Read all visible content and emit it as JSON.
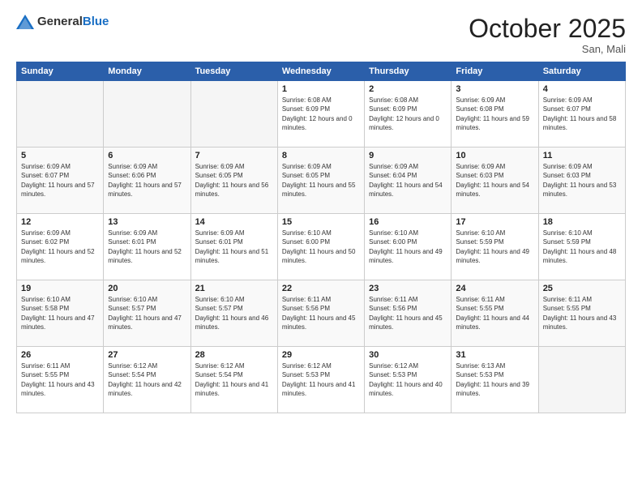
{
  "header": {
    "logo_general": "General",
    "logo_blue": "Blue",
    "month_title": "October 2025",
    "location": "San, Mali"
  },
  "weekdays": [
    "Sunday",
    "Monday",
    "Tuesday",
    "Wednesday",
    "Thursday",
    "Friday",
    "Saturday"
  ],
  "weeks": [
    [
      {
        "day": "",
        "sunrise": "",
        "sunset": "",
        "daylight": ""
      },
      {
        "day": "",
        "sunrise": "",
        "sunset": "",
        "daylight": ""
      },
      {
        "day": "",
        "sunrise": "",
        "sunset": "",
        "daylight": ""
      },
      {
        "day": "1",
        "sunrise": "Sunrise: 6:08 AM",
        "sunset": "Sunset: 6:09 PM",
        "daylight": "Daylight: 12 hours and 0 minutes."
      },
      {
        "day": "2",
        "sunrise": "Sunrise: 6:08 AM",
        "sunset": "Sunset: 6:09 PM",
        "daylight": "Daylight: 12 hours and 0 minutes."
      },
      {
        "day": "3",
        "sunrise": "Sunrise: 6:09 AM",
        "sunset": "Sunset: 6:08 PM",
        "daylight": "Daylight: 11 hours and 59 minutes."
      },
      {
        "day": "4",
        "sunrise": "Sunrise: 6:09 AM",
        "sunset": "Sunset: 6:07 PM",
        "daylight": "Daylight: 11 hours and 58 minutes."
      }
    ],
    [
      {
        "day": "5",
        "sunrise": "Sunrise: 6:09 AM",
        "sunset": "Sunset: 6:07 PM",
        "daylight": "Daylight: 11 hours and 57 minutes."
      },
      {
        "day": "6",
        "sunrise": "Sunrise: 6:09 AM",
        "sunset": "Sunset: 6:06 PM",
        "daylight": "Daylight: 11 hours and 57 minutes."
      },
      {
        "day": "7",
        "sunrise": "Sunrise: 6:09 AM",
        "sunset": "Sunset: 6:05 PM",
        "daylight": "Daylight: 11 hours and 56 minutes."
      },
      {
        "day": "8",
        "sunrise": "Sunrise: 6:09 AM",
        "sunset": "Sunset: 6:05 PM",
        "daylight": "Daylight: 11 hours and 55 minutes."
      },
      {
        "day": "9",
        "sunrise": "Sunrise: 6:09 AM",
        "sunset": "Sunset: 6:04 PM",
        "daylight": "Daylight: 11 hours and 54 minutes."
      },
      {
        "day": "10",
        "sunrise": "Sunrise: 6:09 AM",
        "sunset": "Sunset: 6:03 PM",
        "daylight": "Daylight: 11 hours and 54 minutes."
      },
      {
        "day": "11",
        "sunrise": "Sunrise: 6:09 AM",
        "sunset": "Sunset: 6:03 PM",
        "daylight": "Daylight: 11 hours and 53 minutes."
      }
    ],
    [
      {
        "day": "12",
        "sunrise": "Sunrise: 6:09 AM",
        "sunset": "Sunset: 6:02 PM",
        "daylight": "Daylight: 11 hours and 52 minutes."
      },
      {
        "day": "13",
        "sunrise": "Sunrise: 6:09 AM",
        "sunset": "Sunset: 6:01 PM",
        "daylight": "Daylight: 11 hours and 52 minutes."
      },
      {
        "day": "14",
        "sunrise": "Sunrise: 6:09 AM",
        "sunset": "Sunset: 6:01 PM",
        "daylight": "Daylight: 11 hours and 51 minutes."
      },
      {
        "day": "15",
        "sunrise": "Sunrise: 6:10 AM",
        "sunset": "Sunset: 6:00 PM",
        "daylight": "Daylight: 11 hours and 50 minutes."
      },
      {
        "day": "16",
        "sunrise": "Sunrise: 6:10 AM",
        "sunset": "Sunset: 6:00 PM",
        "daylight": "Daylight: 11 hours and 49 minutes."
      },
      {
        "day": "17",
        "sunrise": "Sunrise: 6:10 AM",
        "sunset": "Sunset: 5:59 PM",
        "daylight": "Daylight: 11 hours and 49 minutes."
      },
      {
        "day": "18",
        "sunrise": "Sunrise: 6:10 AM",
        "sunset": "Sunset: 5:59 PM",
        "daylight": "Daylight: 11 hours and 48 minutes."
      }
    ],
    [
      {
        "day": "19",
        "sunrise": "Sunrise: 6:10 AM",
        "sunset": "Sunset: 5:58 PM",
        "daylight": "Daylight: 11 hours and 47 minutes."
      },
      {
        "day": "20",
        "sunrise": "Sunrise: 6:10 AM",
        "sunset": "Sunset: 5:57 PM",
        "daylight": "Daylight: 11 hours and 47 minutes."
      },
      {
        "day": "21",
        "sunrise": "Sunrise: 6:10 AM",
        "sunset": "Sunset: 5:57 PM",
        "daylight": "Daylight: 11 hours and 46 minutes."
      },
      {
        "day": "22",
        "sunrise": "Sunrise: 6:11 AM",
        "sunset": "Sunset: 5:56 PM",
        "daylight": "Daylight: 11 hours and 45 minutes."
      },
      {
        "day": "23",
        "sunrise": "Sunrise: 6:11 AM",
        "sunset": "Sunset: 5:56 PM",
        "daylight": "Daylight: 11 hours and 45 minutes."
      },
      {
        "day": "24",
        "sunrise": "Sunrise: 6:11 AM",
        "sunset": "Sunset: 5:55 PM",
        "daylight": "Daylight: 11 hours and 44 minutes."
      },
      {
        "day": "25",
        "sunrise": "Sunrise: 6:11 AM",
        "sunset": "Sunset: 5:55 PM",
        "daylight": "Daylight: 11 hours and 43 minutes."
      }
    ],
    [
      {
        "day": "26",
        "sunrise": "Sunrise: 6:11 AM",
        "sunset": "Sunset: 5:55 PM",
        "daylight": "Daylight: 11 hours and 43 minutes."
      },
      {
        "day": "27",
        "sunrise": "Sunrise: 6:12 AM",
        "sunset": "Sunset: 5:54 PM",
        "daylight": "Daylight: 11 hours and 42 minutes."
      },
      {
        "day": "28",
        "sunrise": "Sunrise: 6:12 AM",
        "sunset": "Sunset: 5:54 PM",
        "daylight": "Daylight: 11 hours and 41 minutes."
      },
      {
        "day": "29",
        "sunrise": "Sunrise: 6:12 AM",
        "sunset": "Sunset: 5:53 PM",
        "daylight": "Daylight: 11 hours and 41 minutes."
      },
      {
        "day": "30",
        "sunrise": "Sunrise: 6:12 AM",
        "sunset": "Sunset: 5:53 PM",
        "daylight": "Daylight: 11 hours and 40 minutes."
      },
      {
        "day": "31",
        "sunrise": "Sunrise: 6:13 AM",
        "sunset": "Sunset: 5:53 PM",
        "daylight": "Daylight: 11 hours and 39 minutes."
      },
      {
        "day": "",
        "sunrise": "",
        "sunset": "",
        "daylight": ""
      }
    ]
  ]
}
